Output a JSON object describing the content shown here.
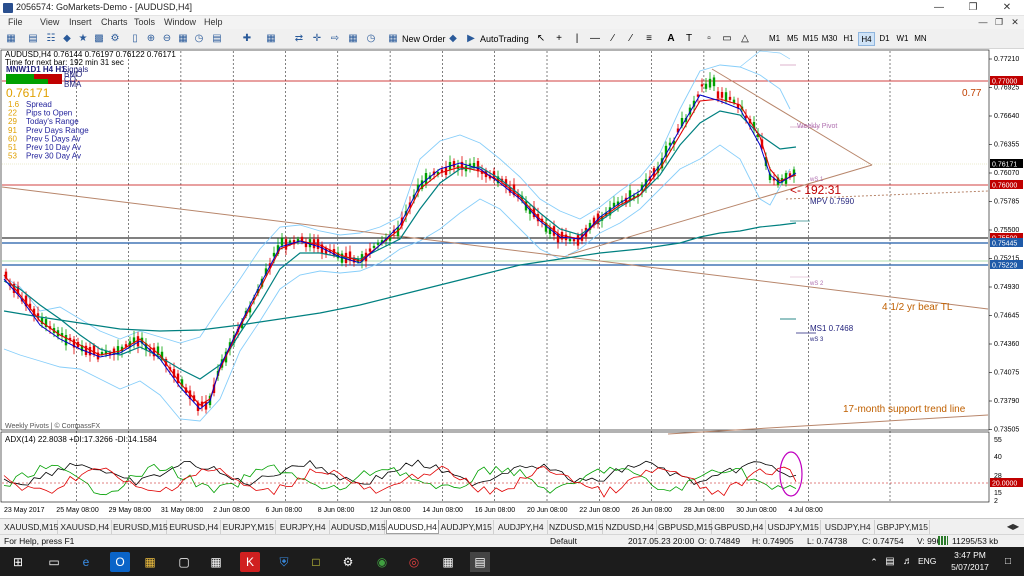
{
  "window": {
    "title": "2056574: GoMarkets-Demo - [AUDUSD,H4]"
  },
  "menu": [
    "File",
    "View",
    "Insert",
    "Charts",
    "Tools",
    "Window",
    "Help"
  ],
  "toolbar": {
    "new_order": "New Order",
    "autotrading": "AutoTrading",
    "timeframes": [
      "M1",
      "M5",
      "M15",
      "M30",
      "H1",
      "H4",
      "D1",
      "W1",
      "MN"
    ],
    "active_timeframe": "H4"
  },
  "chart": {
    "header": "AUDUSD,H4  0.76144 0.76197 0.76122 0.76171",
    "next_bar": "Time for next bar: 192 min 31 sec",
    "mnw": "MNW1D1 H4 H1",
    "signals_label": "Signals",
    "signal_tags": [
      "BMO",
      "CO",
      "BMA"
    ],
    "price_big": "0.76171",
    "stats": [
      {
        "value": "1.6",
        "label": "Spread"
      },
      {
        "value": "22",
        "label": "Pips to Open"
      },
      {
        "value": "29",
        "label": "Today's Range"
      },
      {
        "value": "91",
        "label": "Prev Days Range"
      },
      {
        "value": "60",
        "label": "Prev 5 Days Av"
      },
      {
        "value": "51",
        "label": "Prev 10 Day Av"
      },
      {
        "value": "53",
        "label": "Prev 30 Day Av"
      }
    ],
    "annotations": {
      "level_077": "0.77",
      "weekly_pivot": "Weekly Pivot",
      "countdown": "<- 192:31",
      "mpv": "MPV  0.7590",
      "bear_tl": "4 1/2 yr bear TL",
      "ms1": "MS1  0.7468",
      "support_tl": "17-month support trend line",
      "ws1": "wS 1",
      "ws2": "wS 2",
      "ws3": "wS 3",
      "watermark": "Weekly Pivots | © CompassFX"
    },
    "price_axis": [
      "0.77210",
      "0.76925",
      "0.76640",
      "0.76355",
      "0.76070",
      "0.75785",
      "0.75500",
      "0.75215",
      "0.74930",
      "0.74645",
      "0.74360",
      "0.74075",
      "0.73790",
      "0.73505"
    ],
    "price_tags": [
      {
        "value": "0.77000",
        "color": "#c00000"
      },
      {
        "value": "0.76171",
        "color": "#000000"
      },
      {
        "value": "0.76000",
        "color": "#c00000"
      },
      {
        "value": "0.75500",
        "color": "#c00000"
      },
      {
        "value": "0.75445",
        "color": "#1f5aa8"
      },
      {
        "value": "0.75229",
        "color": "#1f5aa8"
      }
    ],
    "adx": {
      "header": "ADX(14) 22.8038 +DI:17.3266 -DI:14.1584",
      "axis": [
        "55",
        "40",
        "28",
        "20.0000",
        "15",
        "2"
      ]
    },
    "time_axis": [
      "23 May 2017",
      "25 May 08:00",
      "29 May 08:00",
      "31 May 08:00",
      "2 Jun 08:00",
      "6 Jun 08:00",
      "8 Jun 08:00",
      "12 Jun 08:00",
      "14 Jun 08:00",
      "16 Jun 08:00",
      "20 Jun 08:00",
      "22 Jun 08:00",
      "26 Jun 08:00",
      "28 Jun 08:00",
      "30 Jun 08:00",
      "4 Jul 08:00"
    ],
    "colors": {
      "bull": "#00a000",
      "bear": "#e00000",
      "ema_fast": "#e00000",
      "ema_mid": "#0000c8",
      "ema_slow": "#008080",
      "bands": "#87cefa",
      "trendline": "#b8866b"
    }
  },
  "symbol_tabs": [
    "XAUUSD,M15",
    "XAUUSD,H4",
    "EURUSD,M15",
    "EURUSD,H4",
    "EURJPY,M15",
    "EURJPY,H4",
    "AUDUSD,M15",
    "AUDUSD,H4",
    "AUDJPY,M15",
    "AUDJPY,H4",
    "NZDUSD,M15",
    "NZDUSD,H4",
    "GBPUSD,M15",
    "GBPUSD,H4",
    "USDJPY,M15",
    "USDJPY,H4",
    "GBPJPY,M15"
  ],
  "active_tab": "AUDUSD,H4",
  "status": {
    "help": "For Help, press F1",
    "profile": "Default",
    "datetime": "2017.05.23 20:00",
    "open": "O: 0.74849",
    "high": "H: 0.74905",
    "low": "L: 0.74738",
    "close": "C: 0.74754",
    "volume": "V: 9967",
    "traffic": "11295/53 kb"
  },
  "taskbar": {
    "lang": "ENG",
    "time": "3:47 PM",
    "date": "5/07/2017"
  }
}
